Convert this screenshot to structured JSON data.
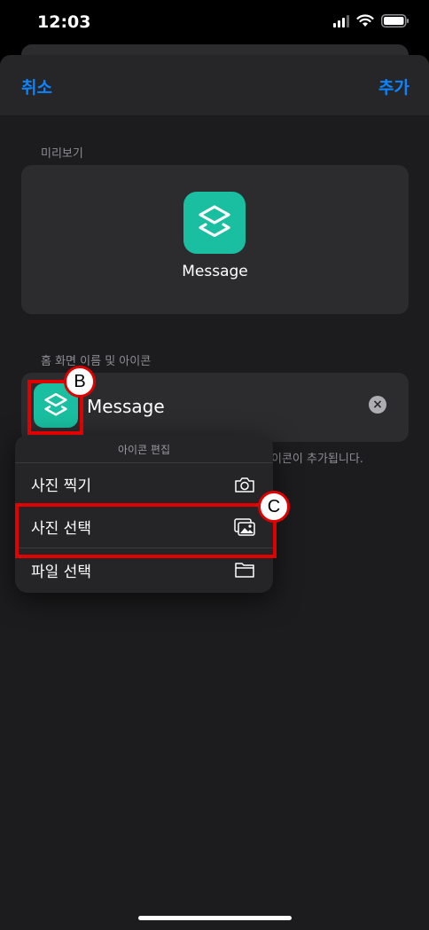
{
  "status": {
    "time": "12:03"
  },
  "nav": {
    "cancel_label": "취소",
    "add_label": "추가"
  },
  "preview": {
    "section_label": "미리보기",
    "app_name": "Message"
  },
  "home": {
    "section_label": "홈 화면 이름 및 아이콘",
    "name_value": "Message",
    "hint_fragment": "이콘이 추가됩니다."
  },
  "icon_menu": {
    "title": "아이콘 편집",
    "items": [
      {
        "label": "사진 찍기",
        "icon": "camera-icon"
      },
      {
        "label": "사진 선택",
        "icon": "photo-icon"
      },
      {
        "label": "파일 선택",
        "icon": "folder-icon"
      }
    ]
  },
  "annotations": {
    "marker_b": "B",
    "marker_c": "C",
    "color": "#e00000"
  },
  "colors": {
    "accent": "#0a84ff",
    "app_icon": "#19bfa0"
  }
}
